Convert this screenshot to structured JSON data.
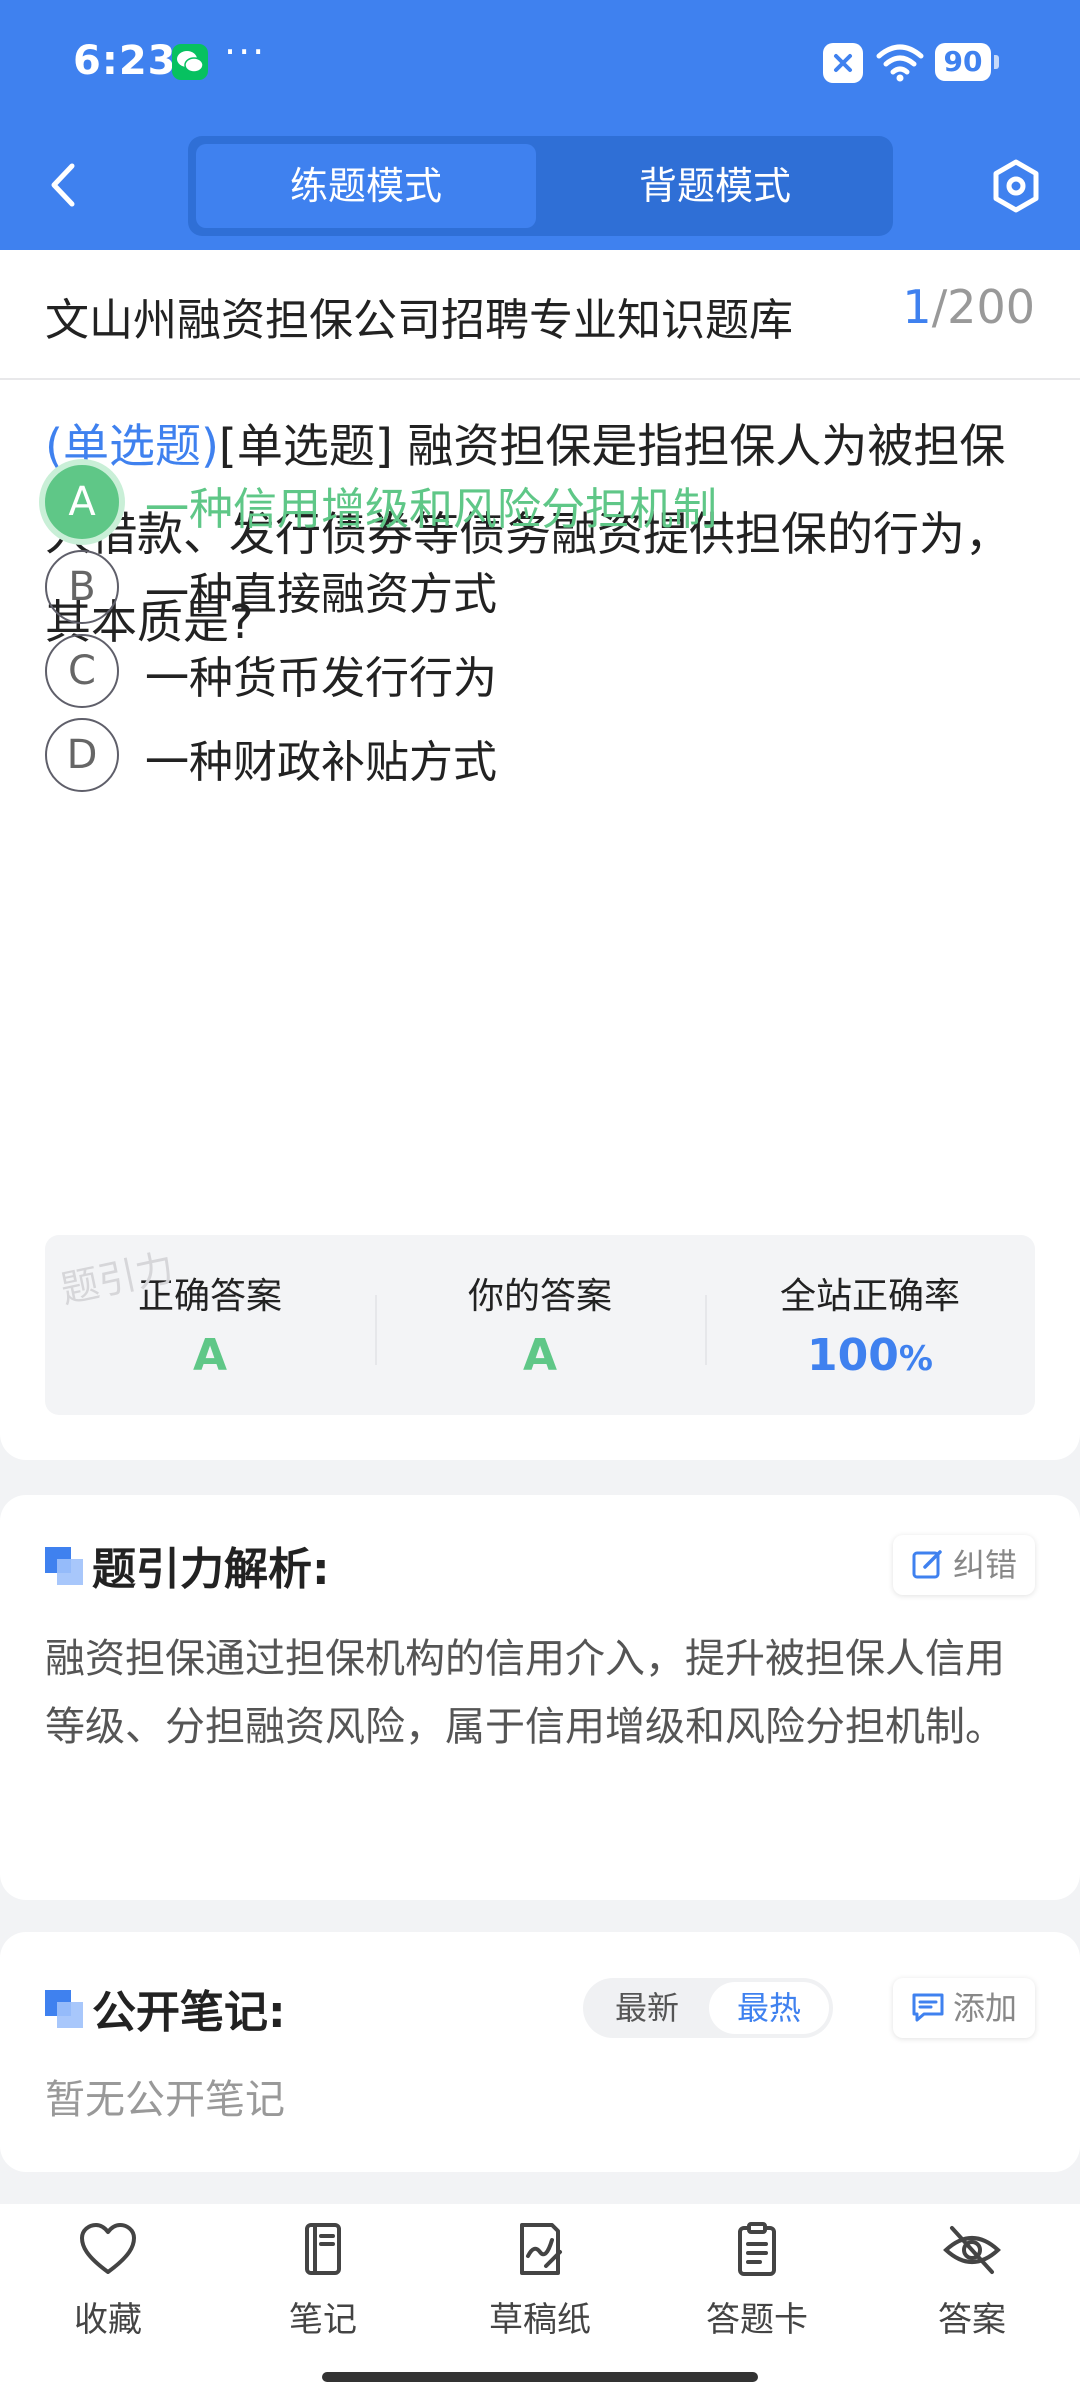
{
  "status_bar": {
    "time": "6:23",
    "more": "···",
    "battery": "90"
  },
  "header": {
    "tabs": [
      {
        "label": "练题模式",
        "active": true
      },
      {
        "label": "背题模式",
        "active": false
      }
    ],
    "accent_color": "#3f81ef"
  },
  "bank": {
    "title": "文山州融资担保公司招聘专业知识题库",
    "current": "1",
    "total": "/200"
  },
  "question": {
    "type_tag": "(单选题)",
    "text": "[单选题] 融资担保是指担保人为被担保人借款、发行债券等债务融资提供担保的行为，其本质是?"
  },
  "options": [
    {
      "letter": "A",
      "text": "一种信用增级和风险分担机制",
      "state": "correct"
    },
    {
      "letter": "B",
      "text": "一种直接融资方式",
      "state": "normal"
    },
    {
      "letter": "C",
      "text": "一种货币发行行为",
      "state": "normal"
    },
    {
      "letter": "D",
      "text": "一种财政补贴方式",
      "state": "normal"
    }
  ],
  "stats": {
    "correct_label": "正确答案",
    "correct_value": "A",
    "yours_label": "你的答案",
    "yours_value": "A",
    "rate_label": "全站正确率",
    "rate_value": "100",
    "rate_unit": "%",
    "watermark": "题引力"
  },
  "analysis": {
    "title": "题引力解析:",
    "report_label": "纠错",
    "text": "融资担保通过担保机构的信用介入，提升被担保人信用等级、分担融资风险，属于信用增级和风险分担机制。"
  },
  "notes": {
    "title": "公开笔记:",
    "sort_newest": "最新",
    "sort_hottest": "最热",
    "add_label": "添加",
    "empty_text": "暂无公开笔记"
  },
  "bottom_nav": [
    {
      "label": "收藏",
      "icon": "heart-icon"
    },
    {
      "label": "笔记",
      "icon": "notebook-icon"
    },
    {
      "label": "草稿纸",
      "icon": "scratch-paper-icon"
    },
    {
      "label": "答题卡",
      "icon": "answer-sheet-icon"
    },
    {
      "label": "答案",
      "icon": "eye-off-icon"
    }
  ],
  "colors": {
    "correct_green": "#5fc787",
    "primary_blue": "#3f81ef"
  }
}
